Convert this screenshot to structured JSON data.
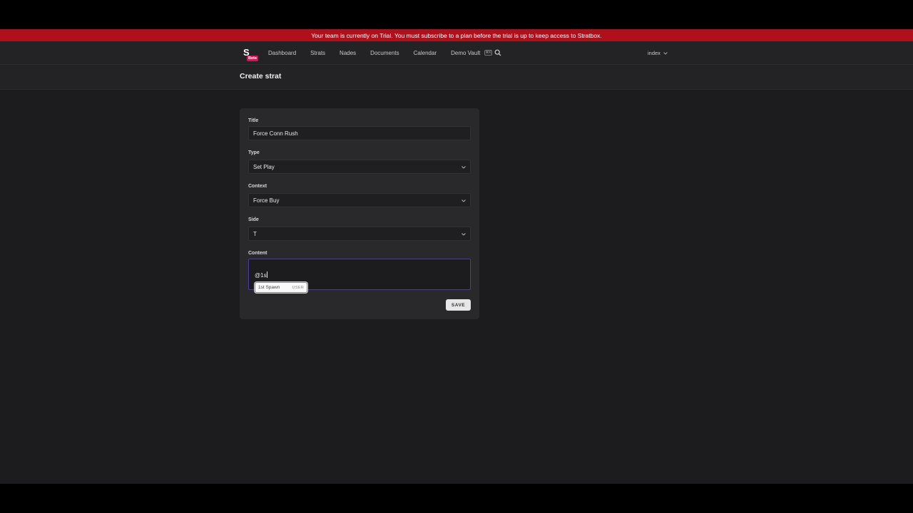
{
  "banner": {
    "text": "Your team is currently on Trial. You must subscribe to a plan before the trial is up to keep access to Stratbox."
  },
  "logo": {
    "letter": "S",
    "badge": "Beta"
  },
  "nav": {
    "items": [
      {
        "label": "Dashboard"
      },
      {
        "label": "Strats"
      },
      {
        "label": "Nades"
      },
      {
        "label": "Documents"
      },
      {
        "label": "Calendar"
      },
      {
        "label": "Demo Vault"
      }
    ],
    "shortcut_key": "⌘K",
    "team_name": "index"
  },
  "page": {
    "title": "Create strat"
  },
  "form": {
    "title_label": "Title",
    "title_value": "Force Conn Rush",
    "type_label": "Type",
    "type_value": "Set Play",
    "context_label": "Context",
    "context_value": "Force Buy",
    "side_label": "Side",
    "side_value": "T",
    "content_label": "Content",
    "content_value": "@1s",
    "mention_suggestion": {
      "name": "1st Spawn",
      "tag": "USER"
    },
    "save_label": "SAVE"
  },
  "colors": {
    "banner": "#b0101c",
    "accent": "#4a3aa8",
    "badge": "#d4145a"
  }
}
